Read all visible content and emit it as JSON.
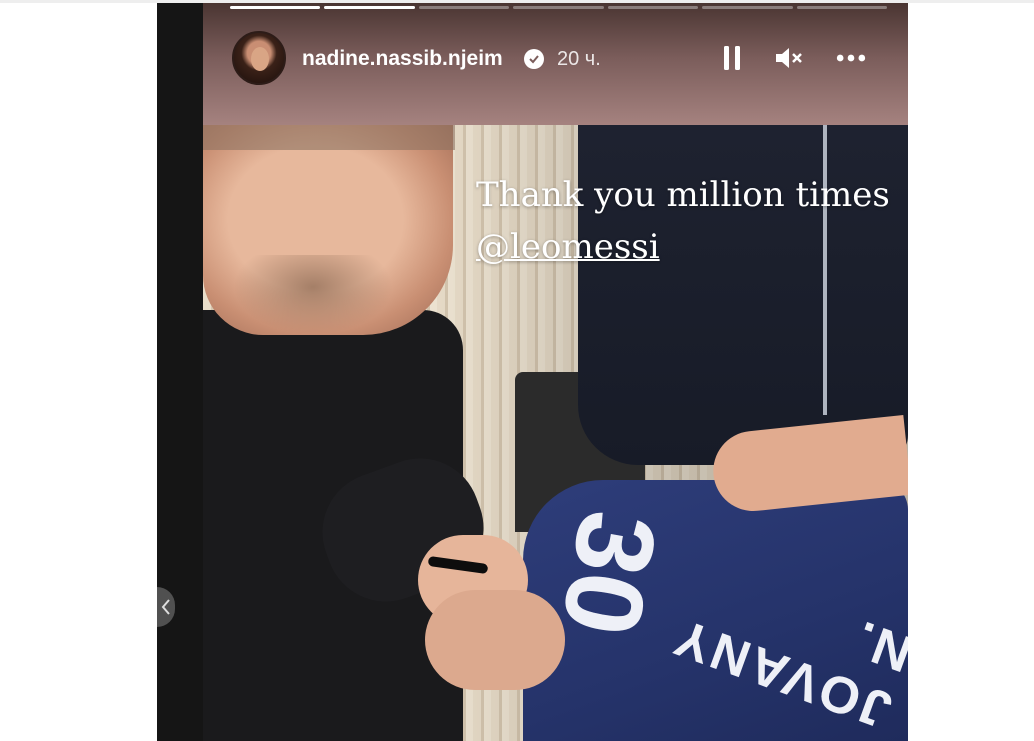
{
  "story": {
    "username": "nadine.nassib.njeim",
    "time": "20 ч.",
    "progress": [
      1,
      1,
      0,
      0,
      0,
      0,
      0
    ],
    "caption_line1": "Thank you million times",
    "caption_mention": "@leomessi",
    "shirt_name": "JOVANY N.",
    "shirt_number": "30"
  },
  "icons": {
    "verified": "verified-badge-icon",
    "pause": "pause-icon",
    "mute": "muted-speaker-icon",
    "more": "more-dots-icon",
    "prev": "chevron-left-icon"
  },
  "colors": {
    "header_top": "#4a3532",
    "header_bottom": "#a5827f",
    "text": "#ffffff"
  }
}
